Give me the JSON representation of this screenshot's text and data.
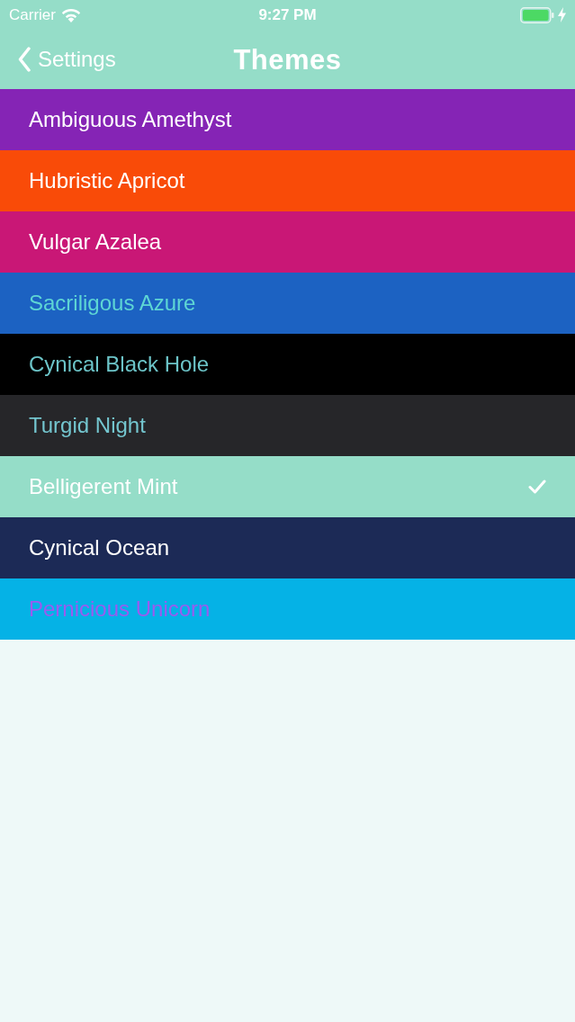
{
  "status_bar": {
    "carrier": "Carrier",
    "time": "9:27 PM",
    "charging": true
  },
  "nav_bar": {
    "back_label": "Settings",
    "title": "Themes"
  },
  "themes": [
    {
      "color": "#8524b5",
      "selected": false,
      "label": {
        "text": "Ambiguous Amethyst",
        "color": "#ffffff"
      }
    },
    {
      "color": "#f94b08",
      "selected": false,
      "label": {
        "text": "Hubristic Apricot",
        "color": "#ffffff"
      }
    },
    {
      "color": "#c91776",
      "selected": false,
      "label": {
        "text": "Vulgar Azalea",
        "color": "#ffffff"
      }
    },
    {
      "color": "#1c62c2",
      "selected": false,
      "label": {
        "text": "Sacriligous Azure",
        "color": "#5ed6d4"
      }
    },
    {
      "color": "#000000",
      "selected": false,
      "label": {
        "text": "Cynical Black Hole",
        "color": "#6cc4c8"
      }
    },
    {
      "color": "#262629",
      "selected": false,
      "label": {
        "text": "Turgid Night",
        "color": "#74c6cf"
      }
    },
    {
      "color": "#95ddc8",
      "selected": true,
      "label": {
        "text": "Belligerent Mint",
        "color": "#ffffff"
      }
    },
    {
      "color": "#1c2a56",
      "selected": false,
      "label": {
        "text": "Cynical Ocean",
        "color": "#ffffff"
      }
    },
    {
      "color": "#05b2e6",
      "selected": false,
      "label": {
        "text": "Pernicious Unicorn",
        "color": "#9a5bef"
      }
    }
  ]
}
